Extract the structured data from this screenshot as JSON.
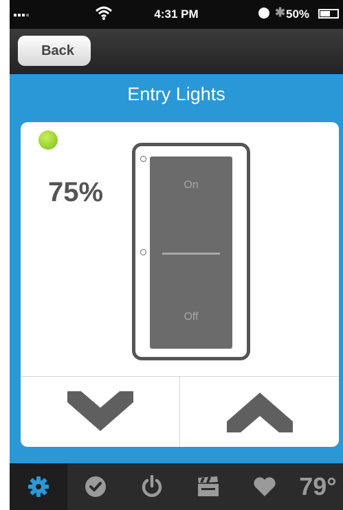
{
  "status_bar": {
    "time": "4:31 PM",
    "battery": "50%"
  },
  "nav": {
    "back_label": "Back"
  },
  "page": {
    "title": "Entry Lights"
  },
  "light": {
    "level": "75%",
    "level_fraction": 0.75,
    "indicator_color": "#8fd12a",
    "switch_on_label": "On",
    "switch_off_label": "Off"
  },
  "controls": {
    "down_icon": "chevron-down-icon",
    "up_icon": "chevron-up-icon"
  },
  "tabbar": {
    "items": [
      {
        "icon": "gear-icon",
        "active": true
      },
      {
        "icon": "checkmark-icon",
        "active": false
      },
      {
        "icon": "power-icon",
        "active": false
      },
      {
        "icon": "clapperboard-icon",
        "active": false
      },
      {
        "icon": "heart-icon",
        "active": false
      }
    ],
    "temperature": "79°"
  },
  "colors": {
    "accent_blue": "#2a98d6",
    "tab_active_icon": "#2a98d6",
    "tab_icon": "#9a9a9a"
  }
}
